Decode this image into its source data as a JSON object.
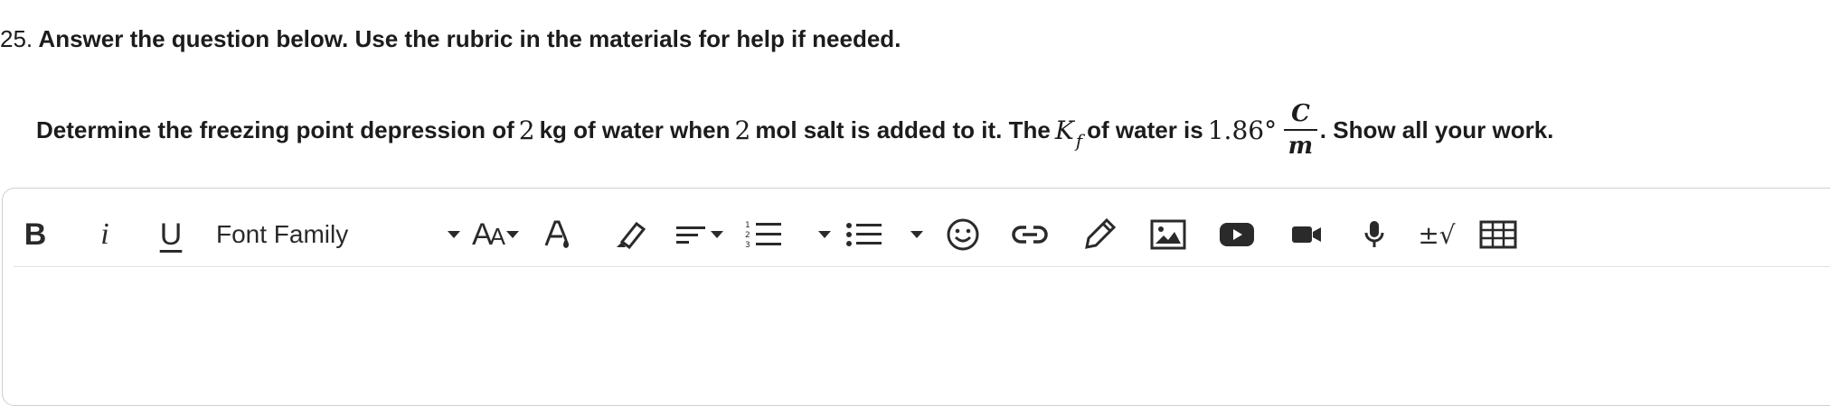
{
  "question": {
    "number": "25.",
    "instruction": "Answer the question below. Use the rubric in the materials for help if needed.",
    "prompt": {
      "part1": "Determine the freezing point depression of",
      "mass_value": "2",
      "part2": "kg of water when",
      "mol_value": "2",
      "part3": "mol salt is added to it. The",
      "kf_symbol": "K",
      "kf_subscript": "f",
      "part4": "of water is",
      "kf_value": "1.86°",
      "frac_numerator": "C",
      "frac_denominator": "m",
      "part5": ". Show all your work."
    }
  },
  "toolbar": {
    "bold": "B",
    "italic": "i",
    "underline": "U",
    "font_family": "Font Family",
    "font_size_big": "A",
    "font_size_small": "A",
    "equation": "±√",
    "icons": [
      "bold-icon",
      "italic-icon",
      "underline-icon",
      "font-family-dropdown",
      "font-size-icon",
      "text-color-icon",
      "highlight-icon",
      "align-icon",
      "numbered-list-icon",
      "bullet-list-icon",
      "emoji-icon",
      "link-icon",
      "draw-icon",
      "image-icon",
      "youtube-icon",
      "video-icon",
      "microphone-icon",
      "equation-icon",
      "table-icon"
    ]
  }
}
